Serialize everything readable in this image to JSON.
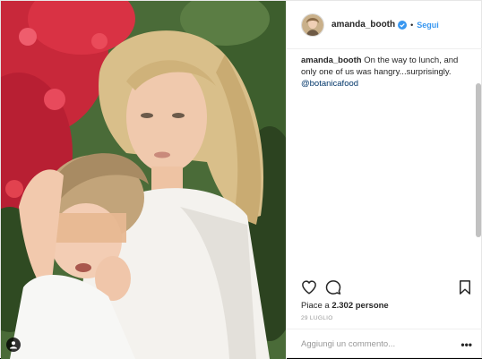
{
  "header": {
    "username": "amanda_booth",
    "separator": "•",
    "follow_label": "Segui"
  },
  "caption": {
    "username": "amanda_booth",
    "text": "On the way to lunch, and only one of us was hangry...surprisingly.",
    "mention": "@botanicafood"
  },
  "engagement": {
    "likes_prefix": "Piace a",
    "likes_count": "2.302",
    "likes_suffix": "persone",
    "date": "29 LUGLIO"
  },
  "comment": {
    "placeholder": "Aggiungi un commento...",
    "more_label": "•••"
  },
  "icons": {
    "like": "heart-icon",
    "comment": "comment-icon",
    "save": "bookmark-icon",
    "verified": "verified-badge-icon",
    "tagged": "user-tag-icon"
  },
  "colors": {
    "link_blue": "#3897f0",
    "mention_blue": "#003569",
    "verified_blue": "#3897f0"
  }
}
